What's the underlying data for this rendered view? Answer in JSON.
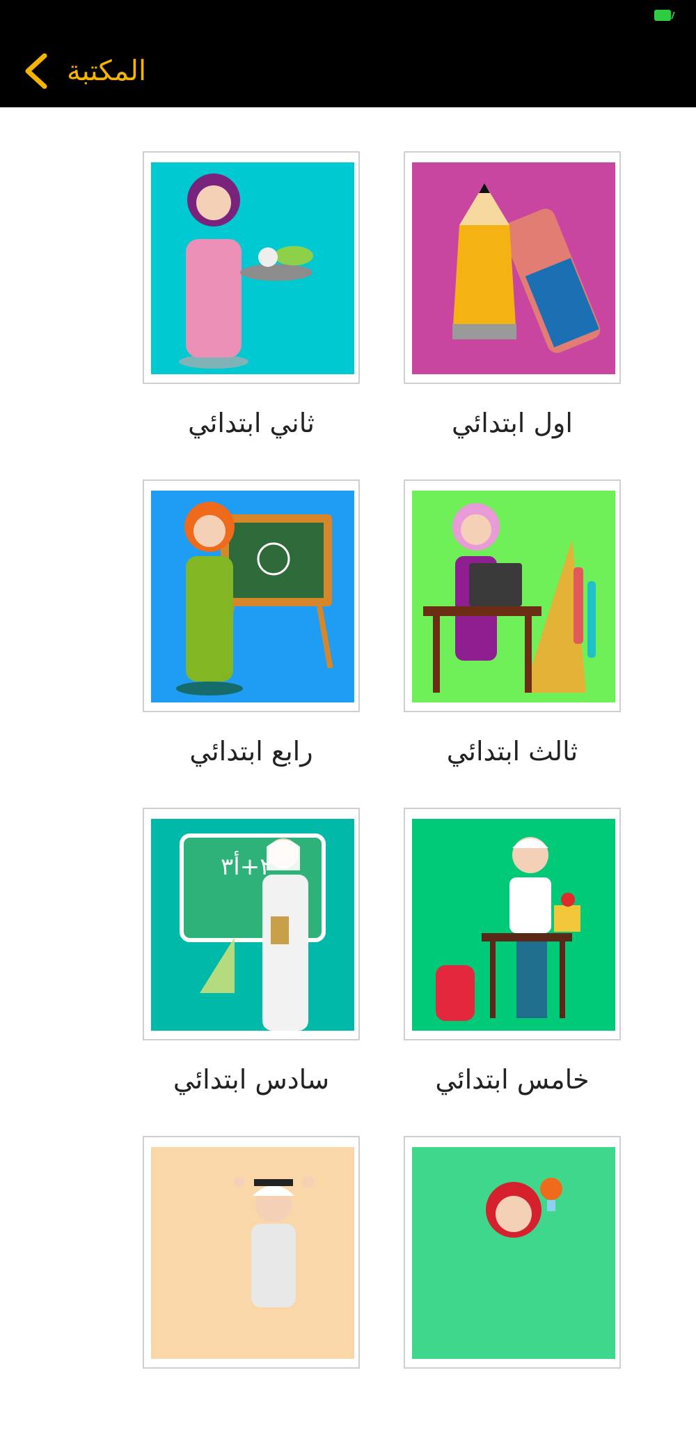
{
  "header": {
    "back_label": "المكتبة"
  },
  "grades": [
    {
      "label": "اول ابتدائي",
      "bg": "#c845a0"
    },
    {
      "label": "ثاني ابتدائي",
      "bg": "#00c9d1"
    },
    {
      "label": "ثالث ابتدائي",
      "bg": "#6ff058"
    },
    {
      "label": "رابع ابتدائي",
      "bg": "#1f9cf4"
    },
    {
      "label": "خامس ابتدائي",
      "bg": "#00c977"
    },
    {
      "label": "سادس ابتدائي",
      "bg": "#00b9a9"
    },
    {
      "label": "",
      "bg": "#3fd78b"
    },
    {
      "label": "",
      "bg": "#f9d7a8"
    }
  ],
  "colors": {
    "appbar": "#000000",
    "accent": "#f5b400"
  }
}
